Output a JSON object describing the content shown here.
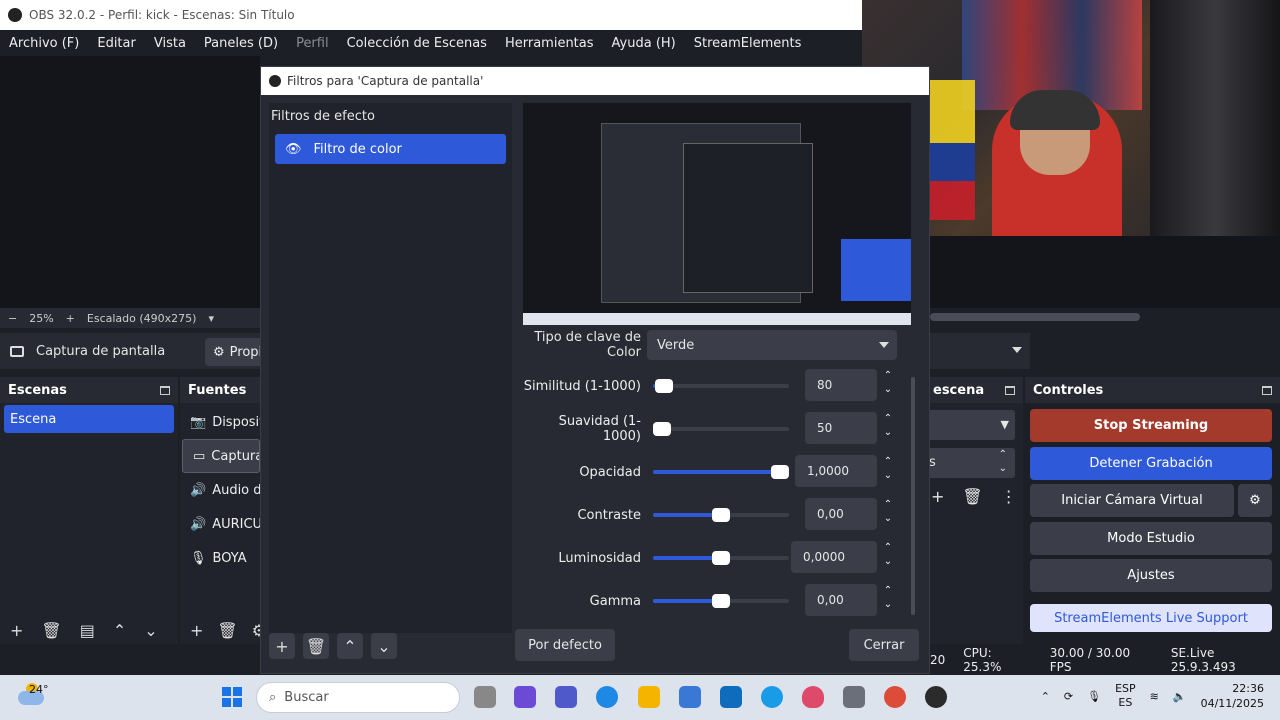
{
  "window": {
    "title": "OBS 32.0.2 - Perfil: kick - Escenas: Sin Título"
  },
  "menu": [
    {
      "label": "Archivo (F)",
      "enabled": true
    },
    {
      "label": "Editar",
      "enabled": true
    },
    {
      "label": "Vista",
      "enabled": true
    },
    {
      "label": "Paneles (D)",
      "enabled": true
    },
    {
      "label": "Perfil",
      "enabled": false
    },
    {
      "label": "Colección de Escenas",
      "enabled": true
    },
    {
      "label": "Herramientas",
      "enabled": true
    },
    {
      "label": "Ayuda (H)",
      "enabled": true
    },
    {
      "label": "StreamElements",
      "enabled": true
    }
  ],
  "zoombar": {
    "minus": "−",
    "zoom": "25%",
    "plus": "+",
    "scale": "Escalado (490x275)"
  },
  "source_bar": {
    "name": "Captura de pantalla",
    "props_label": "Propi"
  },
  "scenes": {
    "title": "Escenas",
    "items": [
      "Escena"
    ]
  },
  "sources": {
    "title": "Fuentes",
    "items": [
      {
        "icon": "camera-icon",
        "label": "Dispositi"
      },
      {
        "icon": "monitor-icon",
        "label": "Captura"
      },
      {
        "icon": "speaker-icon",
        "label": "Audio de"
      },
      {
        "icon": "speaker-icon",
        "label": "AURICUL"
      },
      {
        "icon": "microphone-icon",
        "label": "BOYA"
      }
    ]
  },
  "transitions": {
    "title": "escena",
    "mid_label": "s"
  },
  "controls": {
    "title": "Controles",
    "stop_streaming": "Stop Streaming",
    "stop_recording": "Detener Grabación",
    "virtual_cam": "Iniciar Cámara Virtual",
    "studio_mode": "Modo Estudio",
    "settings": "Ajustes",
    "se_support": "StreamElements Live Support"
  },
  "status": {
    "left": "20",
    "cpu": "CPU: 25.3%",
    "fps": "30.00 / 30.00 FPS",
    "se": "SE.Live 25.9.3.493"
  },
  "dialog": {
    "title": "Filtros para 'Captura de pantalla'",
    "effects_label": "Filtros de efecto",
    "filter_item": "Filtro de color",
    "color_key_label": "Tipo de clave de Color",
    "color_key_value": "Verde",
    "props": [
      {
        "label": "Similitud (1-1000)",
        "value": "80",
        "level": 0.08
      },
      {
        "label": "Suavidad (1-1000)",
        "value": "50",
        "level": 0.05
      },
      {
        "label": "Opacidad",
        "value": "1,0000",
        "level": 1.0
      },
      {
        "label": "Contraste",
        "value": "0,00",
        "level": 0.5
      },
      {
        "label": "Luminosidad",
        "value": "0,0000",
        "level": 0.5
      },
      {
        "label": "Gamma",
        "value": "0,00",
        "level": 0.5
      }
    ],
    "defaults_button": "Por defecto",
    "close_button": "Cerrar"
  },
  "taskbar": {
    "temp": "24°",
    "search_placeholder": "Buscar",
    "lang1": "ESP",
    "lang2": "ES",
    "time": "22:36",
    "date": "04/11/2025"
  },
  "colors": {
    "accent": "#2e59d9",
    "stop_streaming": "#a33a2c",
    "se_support_bg": "#dfe3fb",
    "se_support_text": "#2e59d9"
  }
}
